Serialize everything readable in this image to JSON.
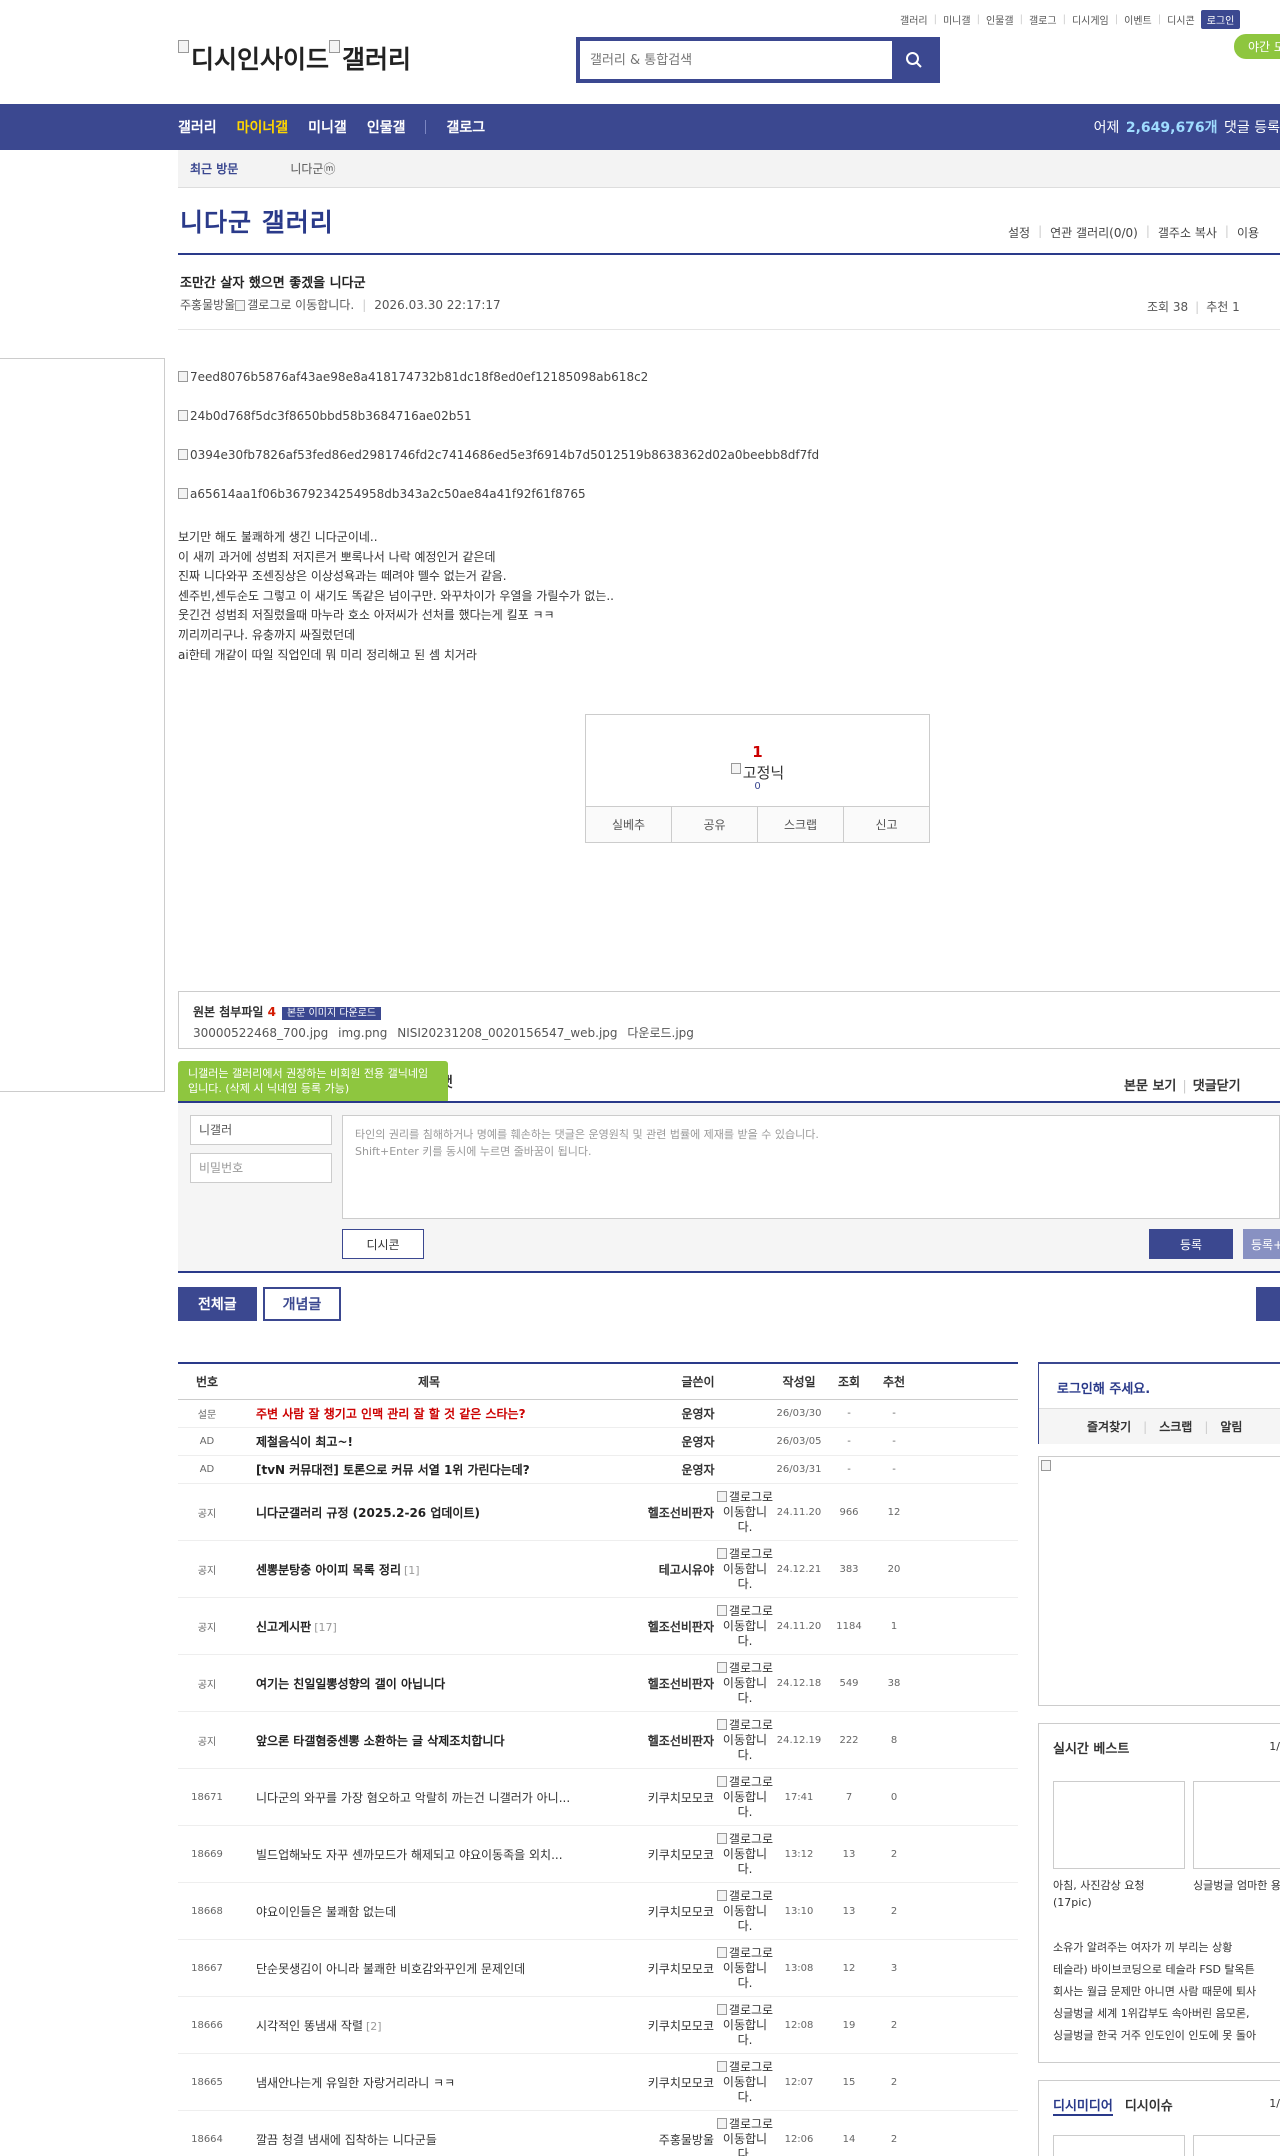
{
  "top_links": [
    "갤러리",
    "미니갤",
    "인물갤",
    "갤로그",
    "디시게임",
    "이벤트",
    "디시콘"
  ],
  "login_label": "로그인",
  "night_mode_label": "야간 모드",
  "logo": {
    "alt1": "디시인사이드",
    "alt2": "갤러리"
  },
  "search": {
    "placeholder": "갤러리 & 통합검색"
  },
  "nav": {
    "items": [
      "갤러리",
      "마이너갤",
      "미니갤",
      "인물갤",
      "갤로그"
    ],
    "active": "마이너갤",
    "stat_prefix": "어제",
    "stat_count": "2,649,676개",
    "stat_suffix": "댓글 등록"
  },
  "recent": {
    "label": "최근 방문",
    "gallery": "니다군ⓜ"
  },
  "gallery": {
    "title": "니다군 갤러리",
    "menu": [
      "설정",
      "연관 갤러리(0/0)",
      "갤주소 복사",
      "이용"
    ]
  },
  "post": {
    "title": "조만간 살자 했으면 좋겠을 니다군",
    "author": "주홍물방울",
    "author_gallog_alt": "갤로그로 이동합니다.",
    "datetime": "2026.03.30 22:17:17",
    "views": "조회 38",
    "recommend": "추천 1",
    "images": [
      "7eed8076b5876af43ae98e8a418174732b81dc18f8ed0ef12185098ab618c2",
      "24b0d768f5dc3f8650bbd58b3684716ae02b51",
      "0394e30fb7826af53fed86ed2981746fd2c7414686ed5e3f6914b7d5012519b8638362d02a0beebb8df7fd",
      "a65614aa1f06b3679234254958db343a2c50ae84a41f92f61f8765"
    ],
    "body_lines": [
      "보기만 해도 불쾌하게 생긴 니다군이네..",
      "이 새끼 과거에 성범죄 저지른거 뽀록나서 나락 예정인거 같은데",
      "진짜 니다와꾸 조센징상은 이상성욕과는 떼려야 뗄수 없는거 같음.",
      "센주빈,센두순도 그렇고 이 새기도 똑같은 넘이구만. 와꾸차이가 우열을 가릴수가 없는..",
      "웃긴건 성범죄 저질렀을때 마누라 호소 아저씨가 선처를 했다는게 킬포 ㅋㅋ",
      "끼리끼리구나. 유충까지 싸질렀던데",
      "ai한테 개같이 따일 직업인데 뭐 미리 정리해고 된 셈 치거라"
    ]
  },
  "recommend_box": {
    "count": "1",
    "fixed_label": "고정닉",
    "fixed_count": "0",
    "buttons": [
      "실베추",
      "공유",
      "스크랩",
      "신고"
    ]
  },
  "attachments": {
    "label": "원본 첨부파일",
    "count": "4",
    "download_label": "본문 이미지 다운로드",
    "files": [
      "30000522468_700.jpg",
      "img.png",
      "NISI20231208_0020156547_web.jpg",
      "다운로드.jpg"
    ]
  },
  "comment": {
    "tooltip": "니갤러는 갤러리에서 권장하는 비회원 전용 갤닉네임입니다. (삭제 시 닉네임 등록 가능)",
    "header_cut": "댓",
    "links": [
      "본문 보기",
      "댓글닫기"
    ],
    "nickname": "니갤러",
    "password_placeholder": "비밀번호",
    "text_line1": "타인의 권리를 침해하거나 명예를 훼손하는 댓글은 운영원칙 및 관련 법률에 제재를 받을 수 있습니다.",
    "text_line2": "Shift+Enter 키를 동시에 누르면 줄바꿈이 됩니다.",
    "dccon_label": "디시콘",
    "submit_label": "등록",
    "submit2_label": "등록+추천"
  },
  "tabs": {
    "all": "전체글",
    "concept": "개념글"
  },
  "list": {
    "headers": [
      "번호",
      "제목",
      "글쓴이",
      "작성일",
      "조회",
      "추천"
    ],
    "rows": [
      {
        "no": "설문",
        "title": "주변 사람 잘 챙기고 인맥 관리 잘 할 것 같은 스타는?",
        "writer": "운영자",
        "date": "26/03/30",
        "views": "-",
        "rec": "-",
        "style": "red",
        "tall": false
      },
      {
        "no": "AD",
        "title": "제철음식이 최고~!",
        "writer": "운영자",
        "date": "26/03/05",
        "views": "-",
        "rec": "-",
        "style": "b",
        "tall": false
      },
      {
        "no": "AD",
        "title": "[tvN 커뮤대전] 토론으로 커뮤 서열 1위 가린다는데?",
        "writer": "운영자",
        "date": "26/03/31",
        "views": "-",
        "rec": "-",
        "style": "b",
        "tall": false
      },
      {
        "no": "공지",
        "title": "니다군갤러리 규정 (2025.2-26 업데이트)",
        "writer": "헬조선비판자",
        "date": "24.11.20",
        "views": "966",
        "rec": "12",
        "style": "b",
        "tall": true
      },
      {
        "no": "공지",
        "title": "센뽕분탕충 아이피 목록 정리",
        "reply": "[1]",
        "writer": "테고시유야",
        "date": "24.12.21",
        "views": "383",
        "rec": "20",
        "style": "b",
        "tall": true
      },
      {
        "no": "공지",
        "title": "신고게시판",
        "reply": "[17]",
        "writer": "헬조선비판자",
        "date": "24.11.20",
        "views": "1184",
        "rec": "1",
        "style": "b",
        "tall": true
      },
      {
        "no": "공지",
        "title": "여기는 친일일뽕성향의 갤이 아닙니다",
        "writer": "헬조선비판자",
        "date": "24.12.18",
        "views": "549",
        "rec": "38",
        "style": "b",
        "tall": true
      },
      {
        "no": "공지",
        "title": "앞으론 타갤혐중센뽕 소환하는 글 삭제조치합니다",
        "writer": "헬조선비판자",
        "date": "24.12.19",
        "views": "222",
        "rec": "8",
        "style": "b",
        "tall": true
      },
      {
        "no": "18671",
        "title": "니다군의 와꾸를 가장 혐오하고 악랄히 까는건 니갤러가 아니...",
        "writer": "키쿠치모모코",
        "date": "17:41",
        "views": "7",
        "rec": "0",
        "style": "",
        "tall": true
      },
      {
        "no": "18669",
        "title": "빌드업해놔도 자꾸 센까모드가 해제되고 야요이동족을 외치...",
        "writer": "키쿠치모모코",
        "date": "13:12",
        "views": "13",
        "rec": "2",
        "style": "",
        "tall": true
      },
      {
        "no": "18668",
        "title": "야요이인들은 불쾌함 없는데",
        "writer": "키쿠치모모코",
        "date": "13:10",
        "views": "13",
        "rec": "2",
        "style": "",
        "tall": true
      },
      {
        "no": "18667",
        "title": "단순못생김이 아니라 불쾌한 비호감와꾸인게 문제인데",
        "writer": "키쿠치모모코",
        "date": "13:08",
        "views": "12",
        "rec": "3",
        "style": "",
        "tall": true
      },
      {
        "no": "18666",
        "title": "시각적인 똥냄새 작렬",
        "reply": "[2]",
        "writer": "키쿠치모모코",
        "date": "12:08",
        "views": "19",
        "rec": "2",
        "style": "",
        "tall": true
      },
      {
        "no": "18665",
        "title": "냄새안나는게 유일한 자랑거리라니 ㅋㅋ",
        "writer": "키쿠치모모코",
        "date": "12:07",
        "views": "15",
        "rec": "2",
        "style": "",
        "tall": true
      },
      {
        "no": "18664",
        "title": "깔끔 청결 냄새에 집착하는 니다군들",
        "writer": "주홍물방울",
        "date": "12:06",
        "views": "14",
        "rec": "2",
        "style": "",
        "tall": true,
        "gallog_inline": true
      }
    ],
    "gallog_alt": "갤로그로 이동합니다."
  },
  "sidebar": {
    "login_prompt": "로그인해 주세요.",
    "login_links": [
      "즐겨찾기",
      "스크랩",
      "알림"
    ],
    "best_title": "실시간 베스트",
    "best_page": "1/",
    "best_caption1": "아침, 사진감상 요청 (17pic)",
    "best_caption2": "싱글벙글 엄마한 용품 들킨 트랙네",
    "best_list": [
      "소유가 알려주는 여자가 끼 부리는 상황",
      "테슬라) 바이브코딩으로 테슬라 FSD 탈옥튼",
      "회사는 월급 문제만 아니면 사람 때문에 퇴사",
      "싱글벙글 세계 1위갑부도 속아버린 음모론,",
      "싱글벙글 한국 거주 인도인이 인도에 못 돌아"
    ],
    "media_tabs": [
      "디시미디어",
      "디시이슈"
    ],
    "media_page": "1/"
  }
}
